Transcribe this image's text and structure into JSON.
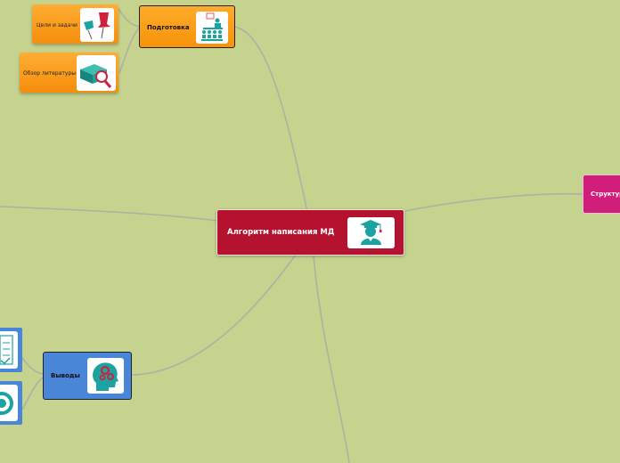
{
  "central": {
    "label": "Алгоритм написания МД",
    "color": "#b51230",
    "icon": "graduate-icon"
  },
  "branches": {
    "preparation": {
      "label": "Подготовка",
      "color": "#fb9f12",
      "icon": "teacher-class-icon"
    },
    "goals": {
      "label": "Цели и задачи",
      "icon": "pushpins-icon"
    },
    "literature": {
      "label": "Обзор литературы",
      "icon": "book-magnifier-icon"
    },
    "structure": {
      "label": "Структур",
      "color": "#d01e7a"
    },
    "conclusions": {
      "label": "Выводы",
      "color": "#4a86d8",
      "icon": "head-gears-icon"
    },
    "side_items": [
      {
        "icon": "checklist-icon"
      },
      {
        "icon": "target-icon"
      }
    ]
  },
  "colors": {
    "background": "#c5d38e",
    "connector": "#a8b3a4"
  }
}
